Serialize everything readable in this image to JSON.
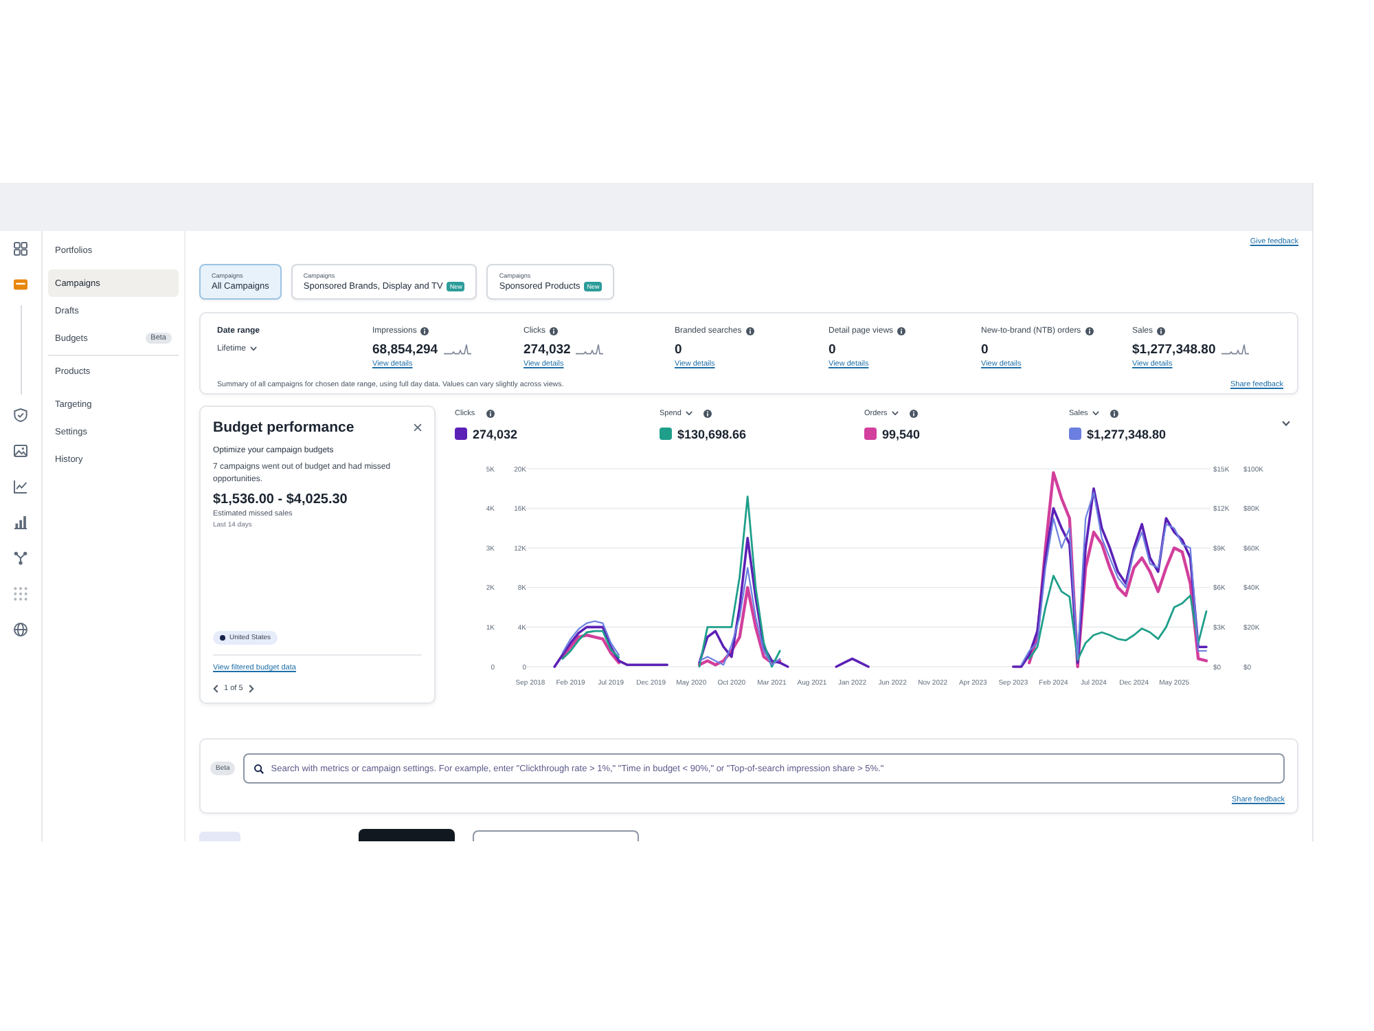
{
  "rail": {
    "sections": [
      {
        "items": [
          {
            "kind": "grid",
            "selected": false
          },
          {
            "kind": "card",
            "selected": true
          }
        ]
      },
      {
        "items": [
          {
            "kind": "shield",
            "selected": false
          },
          {
            "kind": "image",
            "selected": false
          },
          {
            "kind": "line",
            "selected": false
          },
          {
            "kind": "bars",
            "selected": false
          },
          {
            "kind": "branch",
            "selected": false
          },
          {
            "kind": "apps",
            "selected": false
          },
          {
            "kind": "globe",
            "selected": false
          }
        ]
      }
    ]
  },
  "sidebar": {
    "sections": [
      {
        "items": [
          {
            "label": "Portfolios",
            "selected": false
          },
          {
            "label": "Campaigns",
            "selected": true
          },
          {
            "label": "Drafts",
            "selected": false
          },
          {
            "label": "Budgets",
            "selected": false,
            "badge": "Beta"
          }
        ]
      },
      {
        "items": [
          {
            "label": "Products",
            "selected": false
          },
          {
            "label": "Targeting",
            "selected": false
          },
          {
            "label": "Settings",
            "selected": false
          },
          {
            "label": "History",
            "selected": false
          }
        ]
      }
    ]
  },
  "feedback_link": "Give feedback",
  "tabs": [
    {
      "caption": "Campaigns",
      "label": "All Campaigns",
      "selected": true
    },
    {
      "caption": "Campaigns",
      "label": "Sponsored Brands, Display and TV",
      "badge": "New",
      "selected": false
    },
    {
      "caption": "Campaigns",
      "label": "Sponsored Products",
      "badge": "New",
      "selected": false
    }
  ],
  "summary": {
    "date_range": {
      "label": "Date range",
      "value": "Lifetime"
    },
    "metrics": [
      {
        "label": "Impressions",
        "value": "68,854,294",
        "sparkline": true,
        "link": "View details"
      },
      {
        "label": "Clicks",
        "value": "274,032",
        "sparkline": true,
        "link": "View details"
      },
      {
        "label": "Branded searches",
        "value": "0",
        "sparkline": false,
        "link": "View details"
      },
      {
        "label": "Detail page views",
        "value": "0",
        "sparkline": false,
        "link": "View details"
      },
      {
        "label": "New-to-brand (NTB) orders",
        "value": "0",
        "sparkline": false,
        "link": "View details"
      },
      {
        "label": "Sales",
        "value": "$1,277,348.80",
        "sparkline": true,
        "link": "View details"
      }
    ],
    "note": "Summary of all campaigns for chosen date range, using full day data. Values can vary slightly across views.",
    "feedback_link": "Share feedback"
  },
  "budget_panel": {
    "title": "Budget performance",
    "subtitle": "Optimize your campaign budgets",
    "message": "7 campaigns went out of budget and had missed opportunities.",
    "amount": "$1,536.00 - $4,025.30",
    "amount_caption": "Estimated missed sales",
    "period": "Last 14 days",
    "region": "United States",
    "link": "View filtered budget data",
    "pager": "1 of 5"
  },
  "chart": {
    "metrics": [
      {
        "label": "Clicks",
        "dropdown": false,
        "value": "274,032",
        "color": "#5b21b6"
      },
      {
        "label": "Spend",
        "dropdown": true,
        "value": "$130,698.66",
        "color": "#1f9f8a"
      },
      {
        "label": "Orders",
        "dropdown": true,
        "value": "99,540",
        "color": "#d23f9c"
      },
      {
        "label": "Sales",
        "dropdown": true,
        "value": "$1,277,348.80",
        "color": "#6b7fe0"
      }
    ],
    "plots": [
      {
        "chart_data": {
          "type": "line",
          "grid": true,
          "categories": [
            "Sep 2018",
            null,
            null,
            null,
            null,
            "Feb 2019",
            null,
            null,
            null,
            null,
            "Jul 2019",
            null,
            null,
            null,
            null,
            "Dec 2019",
            null,
            null,
            null,
            null,
            "May 2020",
            null,
            null,
            null,
            null,
            "Oct 2020",
            null,
            null,
            null,
            null,
            "Mar 2021",
            null,
            null,
            null,
            null,
            "Aug 2021",
            null,
            null,
            null,
            null,
            "Jan 2022",
            null,
            null,
            null,
            null,
            "Jun 2022",
            null,
            null,
            null,
            null,
            "Nov 2022",
            null,
            null,
            null,
            null,
            "Apr 2023",
            null,
            null,
            null,
            null,
            "Sep 2023",
            null,
            null,
            null,
            null,
            "Feb 2024",
            null,
            null,
            null,
            null,
            "Jul 2024",
            null,
            null,
            null,
            null,
            "Dec 2024",
            null,
            null,
            null,
            null,
            "May 2025",
            null,
            null,
            null,
            null
          ],
          "ylim": [
            0,
            5000
          ],
          "yticks": [
            {
              "value": 0,
              "label": "0"
            },
            {
              "value": 1000,
              "label": "1K"
            },
            {
              "value": 2000,
              "label": "2K"
            },
            {
              "value": 3000,
              "label": "3K"
            },
            {
              "value": 4000,
              "label": "4K"
            },
            {
              "value": 5000,
              "label": "5K"
            }
          ],
          "series": [
            {
              "color": "#d23f9c",
              "values": [
                null,
                null,
                null,
                null,
                250,
                500,
                750,
                800,
                750,
                700,
                350,
                100,
                null,
                null,
                null,
                null,
                null,
                null,
                null,
                null,
                null,
                50,
                150,
                50,
                150,
                400,
                750,
                2000,
                1000,
                250,
                100,
                150,
                null,
                null,
                null,
                null,
                null,
                null,
                null,
                null,
                null,
                null,
                null,
                null,
                null,
                null,
                null,
                null,
                null,
                null,
                null,
                null,
                null,
                null,
                null,
                null,
                null,
                null,
                null,
                null,
                null,
                null,
                100,
                750,
                3000,
                4900,
                4250,
                3750,
                0,
                2500,
                3400,
                3100,
                2500,
                2000,
                1800,
                2500,
                2750,
                2400,
                1900,
                2500,
                3000,
                2900,
                2100,
                200,
                150
              ]
            }
          ]
        }
      },
      {
        "chart_data": {
          "type": "line",
          "categories": [
            null,
            null,
            null,
            null,
            null,
            null,
            null,
            null,
            null,
            null,
            null,
            null,
            null,
            null,
            null,
            null,
            null,
            null,
            null,
            null,
            null,
            null,
            null,
            null,
            null,
            null,
            null,
            null,
            null,
            null,
            null,
            null,
            null,
            null,
            null,
            null,
            null,
            null,
            null,
            null,
            null,
            null,
            null,
            null,
            null,
            null,
            null,
            null,
            null,
            null,
            null,
            null,
            null,
            null,
            null,
            null,
            null,
            null,
            null,
            null,
            null,
            null,
            null,
            null,
            null,
            null,
            null,
            null,
            null,
            null,
            null,
            null,
            null,
            null,
            null,
            null,
            null,
            null,
            null,
            null,
            null,
            null,
            null,
            null,
            null
          ],
          "ylim": [
            0,
            20000
          ],
          "yticks": [
            {
              "value": 0,
              "label": "0"
            },
            {
              "value": 4000,
              "label": "4K"
            },
            {
              "value": 8000,
              "label": "8K"
            },
            {
              "value": 12000,
              "label": "12K"
            },
            {
              "value": 16000,
              "label": "16K"
            },
            {
              "value": 20000,
              "label": "20K"
            }
          ],
          "series": [
            {
              "color": "#5b21b6",
              "values": [
                null,
                null,
                null,
                0,
                1200,
                2400,
                3400,
                4000,
                4000,
                4000,
                2000,
                600,
                200,
                200,
                200,
                200,
                200,
                200,
                null,
                null,
                null,
                400,
                3000,
                3600,
                2000,
                1000,
                6000,
                13000,
                7000,
                2000,
                600,
                400,
                0,
                null,
                null,
                null,
                null,
                null,
                0,
                400,
                800,
                400,
                0,
                null,
                null,
                null,
                null,
                null,
                null,
                null,
                null,
                null,
                null,
                null,
                null,
                null,
                null,
                null,
                null,
                null,
                0,
                0,
                1200,
                3600,
                11000,
                16000,
                14000,
                12400,
                400,
                12000,
                18000,
                14000,
                12000,
                9600,
                8400,
                12000,
                14400,
                11000,
                9600,
                15000,
                13600,
                12800,
                11000,
                2000,
                2000
              ]
            }
          ]
        }
      },
      {
        "chart_data": {
          "type": "line",
          "categories": [
            null,
            null,
            null,
            null,
            null,
            null,
            null,
            null,
            null,
            null,
            null,
            null,
            null,
            null,
            null,
            null,
            null,
            null,
            null,
            null,
            null,
            null,
            null,
            null,
            null,
            null,
            null,
            null,
            null,
            null,
            null,
            null,
            null,
            null,
            null,
            null,
            null,
            null,
            null,
            null,
            null,
            null,
            null,
            null,
            null,
            null,
            null,
            null,
            null,
            null,
            null,
            null,
            null,
            null,
            null,
            null,
            null,
            null,
            null,
            null,
            null,
            null,
            null,
            null,
            null,
            null,
            null,
            null,
            null,
            null,
            null,
            null,
            null,
            null,
            null,
            null,
            null,
            null,
            null,
            null,
            null,
            null,
            null,
            null,
            null
          ],
          "ylim": [
            0,
            15000
          ],
          "yticks": [
            {
              "value": 0,
              "label": "$0"
            },
            {
              "value": 3000,
              "label": "$3K"
            },
            {
              "value": 6000,
              "label": "$6K"
            },
            {
              "value": 9000,
              "label": "$9K"
            },
            {
              "value": 12000,
              "label": "$12K"
            },
            {
              "value": 15000,
              "label": "$15K"
            }
          ],
          "series": [
            {
              "color": "#1f9f8a",
              "values": [
                null,
                null,
                null,
                null,
                600,
                1200,
                2000,
                2600,
                2700,
                2700,
                1300,
                700,
                null,
                null,
                null,
                null,
                null,
                null,
                null,
                null,
                null,
                0,
                3000,
                3000,
                3000,
                3000,
                6800,
                12900,
                6000,
                1800,
                0,
                1200,
                null,
                null,
                null,
                null,
                null,
                null,
                null,
                null,
                null,
                null,
                null,
                null,
                null,
                null,
                null,
                null,
                null,
                null,
                null,
                null,
                null,
                null,
                null,
                null,
                null,
                null,
                null,
                null,
                null,
                null,
                600,
                1500,
                4500,
                6900,
                5700,
                5300,
                500,
                1800,
                2400,
                2600,
                2400,
                2100,
                2000,
                2400,
                2900,
                2600,
                2100,
                3000,
                4500,
                4800,
                5400,
                1800,
                4200
              ]
            }
          ]
        }
      },
      {
        "chart_data": {
          "type": "line",
          "categories": [
            null,
            null,
            null,
            null,
            null,
            null,
            null,
            null,
            null,
            null,
            null,
            null,
            null,
            null,
            null,
            null,
            null,
            null,
            null,
            null,
            null,
            null,
            null,
            null,
            null,
            null,
            null,
            null,
            null,
            null,
            null,
            null,
            null,
            null,
            null,
            null,
            null,
            null,
            null,
            null,
            null,
            null,
            null,
            null,
            null,
            null,
            null,
            null,
            null,
            null,
            null,
            null,
            null,
            null,
            null,
            null,
            null,
            null,
            null,
            null,
            null,
            null,
            null,
            null,
            null,
            null,
            null,
            null,
            null,
            null,
            null,
            null,
            null,
            null,
            null,
            null,
            null,
            null,
            null,
            null,
            null,
            null,
            null,
            null,
            null
          ],
          "ylim": [
            0,
            100000
          ],
          "yticks": [
            {
              "value": 0,
              "label": "$0"
            },
            {
              "value": 20000,
              "label": "$20K"
            },
            {
              "value": 40000,
              "label": "$40K"
            },
            {
              "value": 60000,
              "label": "$60K"
            },
            {
              "value": 80000,
              "label": "$80K"
            },
            {
              "value": 100000,
              "label": "$100K"
            }
          ],
          "series": [
            {
              "color": "#6b7fe0",
              "values": [
                null,
                null,
                null,
                null,
                7000,
                14000,
                19000,
                22000,
                23000,
                22000,
                12000,
                6000,
                null,
                null,
                null,
                null,
                null,
                null,
                null,
                null,
                null,
                3000,
                5000,
                3000,
                1000,
                11000,
                25000,
                50000,
                25000,
                8000,
                1000,
                4000,
                null,
                null,
                null,
                null,
                null,
                null,
                null,
                null,
                null,
                null,
                null,
                null,
                null,
                null,
                null,
                null,
                null,
                null,
                null,
                null,
                null,
                null,
                null,
                null,
                null,
                null,
                null,
                null,
                null,
                1000,
                8000,
                12000,
                50000,
                75000,
                60000,
                70000,
                4000,
                75000,
                88000,
                65000,
                55000,
                45000,
                40000,
                58000,
                68000,
                52000,
                50000,
                72000,
                70000,
                62000,
                60000,
                8000,
                8000
              ]
            }
          ]
        }
      }
    ]
  },
  "search": {
    "badge": "Beta",
    "placeholder": "Search with metrics or campaign settings. For example, enter \"Clickthrough rate > 1%,\" \"Time in budget < 90%,\" or \"Top-of-search impression share > 5%.\"",
    "feedback_link": "Share feedback"
  }
}
